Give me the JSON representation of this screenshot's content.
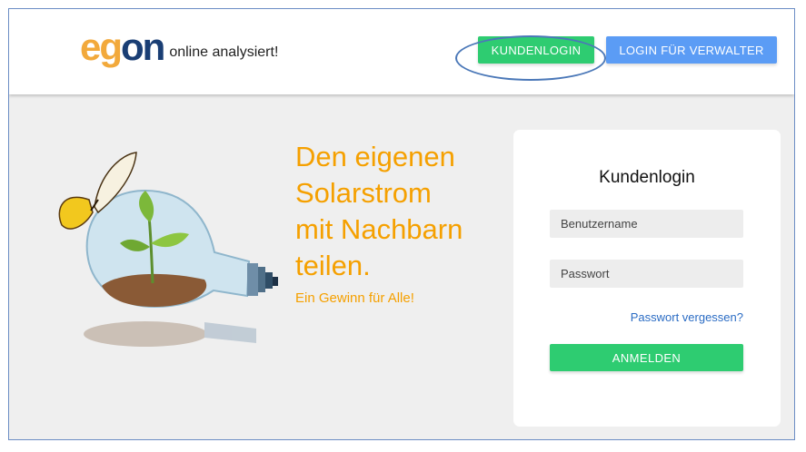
{
  "header": {
    "logo": {
      "e": "e",
      "g": "g",
      "on": "on",
      "tagline": "online analysiert!"
    },
    "buttons": {
      "customer_login": "KUNDENLOGIN",
      "admin_login": "LOGIN FÜR VERWALTER"
    }
  },
  "hero": {
    "headline_lines": [
      "Den eigenen",
      "Solarstrom",
      "mit Nachbarn",
      "teilen."
    ],
    "subline": "Ein Gewinn für Alle!",
    "image_icon": "lightbulb-plant-butterfly-icon"
  },
  "login_card": {
    "title": "Kundenlogin",
    "username_placeholder": "Benutzername",
    "password_placeholder": "Passwort",
    "forgot_password": "Passwort vergessen?",
    "submit_label": "ANMELDEN"
  },
  "colors": {
    "green": "#2ecc71",
    "blue": "#5b9cf5",
    "orange": "#f5a000",
    "logo_navy": "#1a3e74",
    "logo_orange": "#f2a93b",
    "highlight_ellipse": "#4b78b8"
  }
}
